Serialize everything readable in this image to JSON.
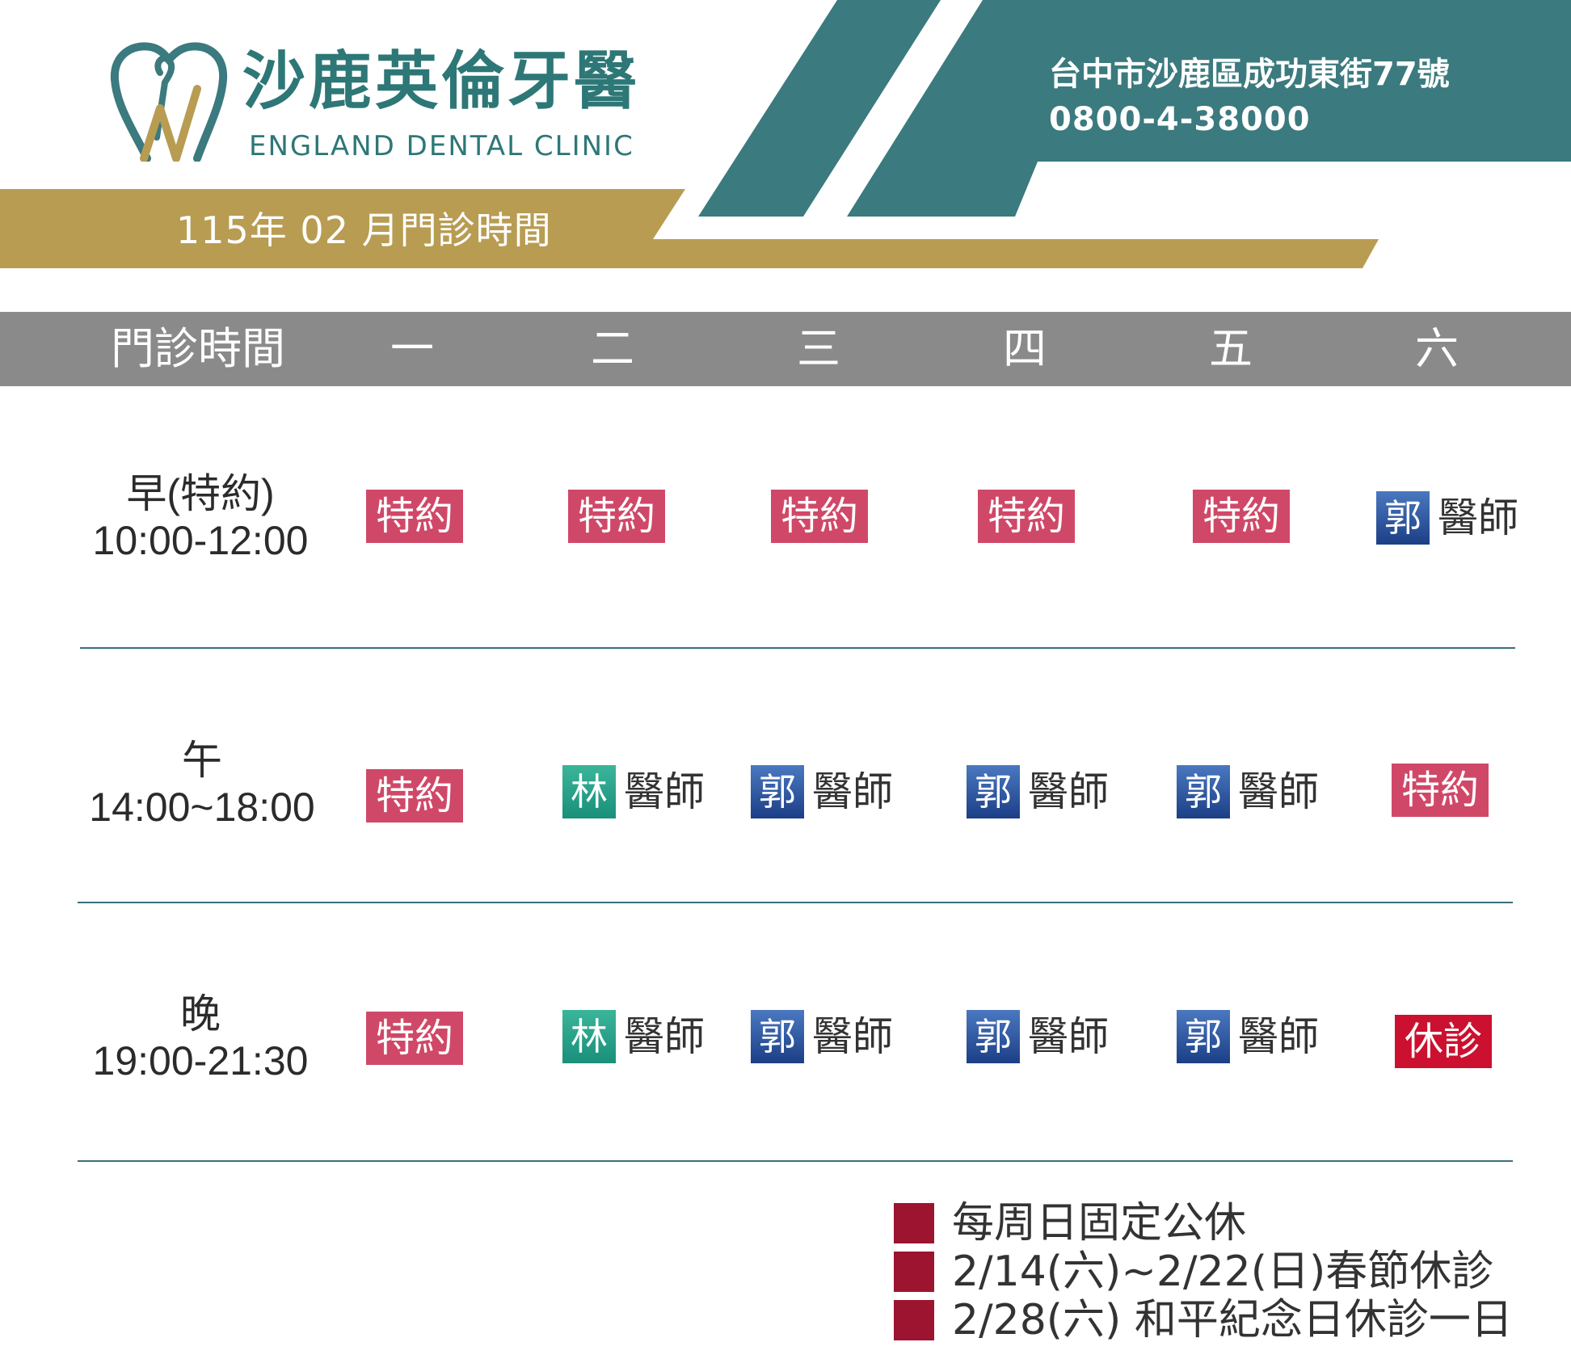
{
  "header": {
    "clinic_name_cn": "沙鹿英倫牙醫",
    "clinic_name_en": "ENGLAND DENTAL CLINIC",
    "month_title": "115年 02 月門診時間",
    "address": "台中市沙鹿區成功東街77號",
    "phone": "0800-4-38000",
    "logo_icon": "tooth-logo-icon"
  },
  "colors": {
    "teal": "#3b7a7e",
    "gold": "#b89c52",
    "header_gray": "#8a8a8a",
    "special_pink": "#d04868",
    "closed_red": "#cc1030",
    "note_square": "#9c1430"
  },
  "table": {
    "columns": [
      "門診時間",
      "一",
      "二",
      "三",
      "四",
      "五",
      "六"
    ],
    "rows": [
      {
        "label": "早(特約)",
        "time": "10:00-12:00",
        "slots": [
          {
            "type": "special",
            "text": "特約"
          },
          {
            "type": "special",
            "text": "特約"
          },
          {
            "type": "special",
            "text": "特約"
          },
          {
            "type": "special",
            "text": "特約"
          },
          {
            "type": "special",
            "text": "特約"
          },
          {
            "type": "doctor",
            "tag": "郭",
            "text": "醫師",
            "color": "guo"
          }
        ]
      },
      {
        "label": "午",
        "time": "14:00~18:00",
        "slots": [
          {
            "type": "special",
            "text": "特約"
          },
          {
            "type": "doctor",
            "tag": "林",
            "text": "醫師",
            "color": "lin"
          },
          {
            "type": "doctor",
            "tag": "郭",
            "text": "醫師",
            "color": "guo"
          },
          {
            "type": "doctor",
            "tag": "郭",
            "text": "醫師",
            "color": "guo"
          },
          {
            "type": "doctor",
            "tag": "郭",
            "text": "醫師",
            "color": "guo"
          },
          {
            "type": "special",
            "text": "特約"
          }
        ]
      },
      {
        "label": "晚",
        "time": "19:00-21:30",
        "slots": [
          {
            "type": "special",
            "text": "特約"
          },
          {
            "type": "doctor",
            "tag": "林",
            "text": "醫師",
            "color": "lin"
          },
          {
            "type": "doctor",
            "tag": "郭",
            "text": "醫師",
            "color": "guo"
          },
          {
            "type": "doctor",
            "tag": "郭",
            "text": "醫師",
            "color": "guo"
          },
          {
            "type": "doctor",
            "tag": "郭",
            "text": "醫師",
            "color": "guo"
          },
          {
            "type": "closed",
            "text": "休診"
          }
        ]
      }
    ]
  },
  "notes": [
    "每周日固定公休",
    "2/14(六)~2/22(日)春節休診",
    "2/28(六) 和平紀念日休診一日"
  ]
}
